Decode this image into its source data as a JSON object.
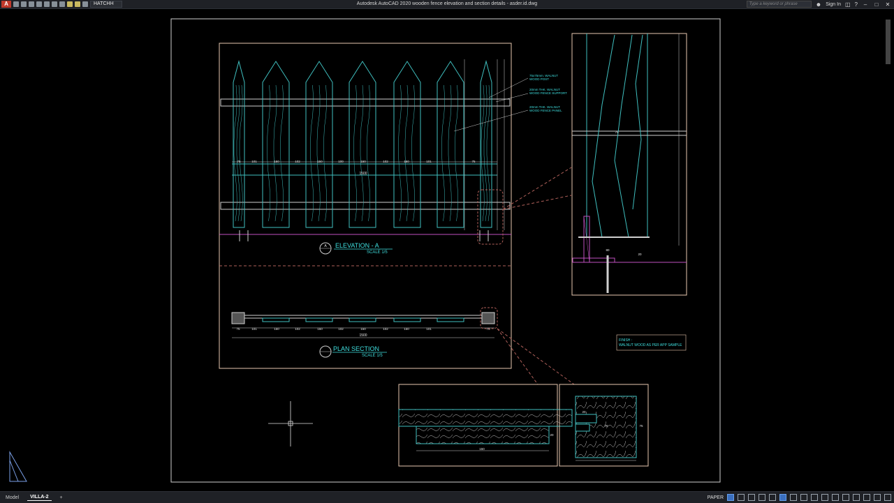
{
  "app": {
    "title": "Autodesk AutoCAD 2020   wooden fence elevation and section details - asder.id.dwg",
    "logo": "A",
    "current_layer": "HATCHH",
    "search_placeholder": "Type a keyword or phrase",
    "sign_in": "Sign In"
  },
  "drawing": {
    "elevation": {
      "title": "ELEVATION - A",
      "scale": "SCALE 1/5",
      "marker": "A",
      "dimensions": [
        "75",
        "101",
        "150",
        "102",
        "150",
        "100",
        "150",
        "102",
        "150",
        "101",
        "75"
      ],
      "total": "1500"
    },
    "plan": {
      "title": "PLAN SECTION",
      "scale": "SCALE 1/5",
      "dimensions": [
        "75",
        "101",
        "150",
        "102",
        "150",
        "102",
        "150",
        "102",
        "150",
        "101",
        "75"
      ],
      "total": "1500"
    },
    "notes": [
      [
        "75x75mm. WALNUT",
        "WOOD POST"
      ],
      [
        "20mm THK. WALNUT",
        "WOOD FENCE SUPPORT"
      ],
      [
        "20mm THK. WALNUT",
        "WOOD FENCE PANEL"
      ]
    ],
    "finish": {
      "label": "FINISH :",
      "text": "WALNUT WOOD AS PER APP SAMPLE"
    },
    "detail_section_dims": [
      "75",
      "80",
      "20"
    ],
    "detail_plan_dims": [
      "150",
      "20",
      "75",
      "75",
      "20",
      "25"
    ]
  },
  "status": {
    "tabs": [
      "Model",
      "VILLA-2",
      "+"
    ],
    "mode": "PAPER"
  }
}
